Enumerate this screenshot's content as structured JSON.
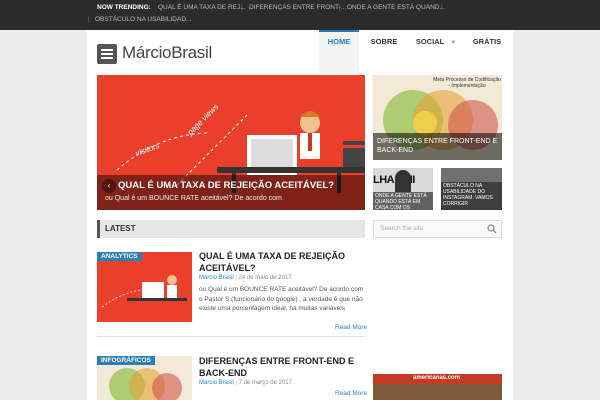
{
  "trending": {
    "label": "NOW TRENDING:",
    "items": [
      "QUAL É UMA TAXA DE REJ...",
      "DIFERENÇAS ENTRE FRONT-...",
      "ONDE A GENTE ESTÁ QUAND...",
      "OBSTÁCULO NA USABILIDAD..."
    ]
  },
  "header": {
    "logo": "MárcioBrasil",
    "nav": [
      "HOME",
      "SOBRE",
      "SOCIAL",
      "GRÁTIS"
    ],
    "active": "HOME"
  },
  "hero": {
    "title": "QUAL É UMA TAXA DE REJEIÇÃO ACEITÁVEL?",
    "excerpt": "ou Qual  é um BOUNCE RATE  aceitável? De acordo com",
    "art_words": [
      "visitors",
      "page views"
    ]
  },
  "featured": [
    {
      "title": "DIFERENÇAS ENTRE FRONT-END E BACK-END",
      "image_title": "Meta Processo de Codificação - Implementação"
    },
    {
      "title": "ONDE A GENTE ESTÁ QUANDO ESTÁ EM CASA COM OS FILHOS?",
      "image_text": "LHA PAII"
    },
    {
      "title": "OBSTÁCULO NA USABILIDADE DO INSTAGRAM. VAMOS CORRIGIR"
    }
  ],
  "latest_label": "LATEST",
  "search_placeholder": "Search the site",
  "posts": [
    {
      "category": "ANALYTICS",
      "title": "QUAL É UMA TAXA DE REJEIÇÃO ACEITÁVEL?",
      "author": "Márcio Brasil",
      "date": "24 de maio de 2017",
      "excerpt": "ou Qual  é um BOUNCE RATE  aceitável? De acordo com o Pastor S (funcionário do google) , a verdade é que não existe uma porcentagem ideal, há muitas variáveis",
      "read_more": "Read More"
    },
    {
      "category": "INFOGRÁFICOS",
      "title": "DIFERENÇAS ENTRE FRONT-END E BACK-END",
      "author": "Márcio Brasil",
      "date": "7 de março de 2017",
      "read_more": "Read More"
    }
  ],
  "ad": {
    "text": "americanas.com"
  },
  "colors": {
    "accent": "#2b7fb8",
    "hero_bg": "#ea3f2a",
    "topbar": "#2b2b2b"
  }
}
